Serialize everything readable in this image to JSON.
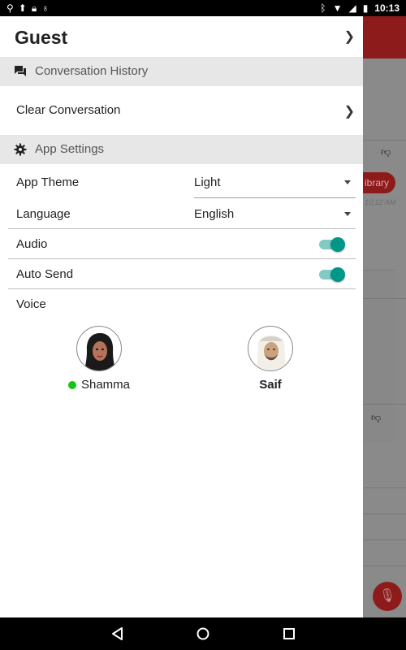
{
  "status_bar": {
    "time": "10:13",
    "left_icons": [
      "usb-icon",
      "upload-icon",
      "lock-icon",
      "android-icon"
    ],
    "right_icons": [
      "bluetooth-icon",
      "wifi-icon",
      "signal-icon",
      "battery-icon"
    ]
  },
  "drawer": {
    "guest_label": "Guest",
    "conversation_section": {
      "icon": "chat-icon",
      "label": "Conversation History"
    },
    "clear_conversation_label": "Clear Conversation",
    "app_settings_section": {
      "icon": "gear-icon",
      "label": "App Settings"
    },
    "settings": {
      "app_theme_label": "App Theme",
      "app_theme_value": "Light",
      "language_label": "Language",
      "language_value": "English",
      "audio_label": "Audio",
      "audio_on": true,
      "auto_send_label": "Auto Send",
      "auto_send_on": true,
      "voice_label": "Voice"
    },
    "voices": [
      {
        "name": "Shamma",
        "selected": true
      },
      {
        "name": "Saif",
        "selected": false
      }
    ]
  },
  "background": {
    "chip_label": "ibrary",
    "timestamp": "10:12 AM"
  },
  "colors": {
    "accent_teal": "#009688",
    "brand_red": "#b71c1c",
    "online_green": "#17c317"
  }
}
